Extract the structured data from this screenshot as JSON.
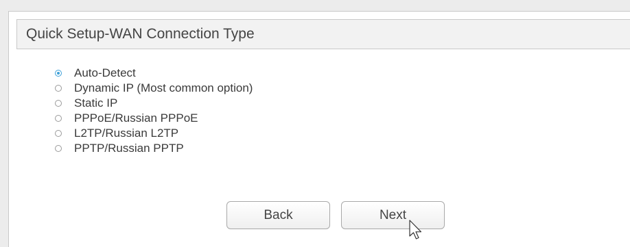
{
  "header": {
    "title": "Quick Setup-WAN Connection Type"
  },
  "connection_types": [
    {
      "label": "Auto-Detect",
      "checked": true
    },
    {
      "label": "Dynamic IP (Most common option)",
      "checked": false
    },
    {
      "label": "Static IP",
      "checked": false
    },
    {
      "label": "PPPoE/Russian PPPoE",
      "checked": false
    },
    {
      "label": "L2TP/Russian L2TP",
      "checked": false
    },
    {
      "label": "PPTP/Russian PPTP",
      "checked": false
    }
  ],
  "buttons": {
    "back_label": "Back",
    "next_label": "Next"
  },
  "colors": {
    "accent": "#3da0d8",
    "header_bg": "#f2f2f2",
    "border": "#c8c8c8"
  },
  "icons": {
    "cursor": "arrow-cursor-icon"
  }
}
